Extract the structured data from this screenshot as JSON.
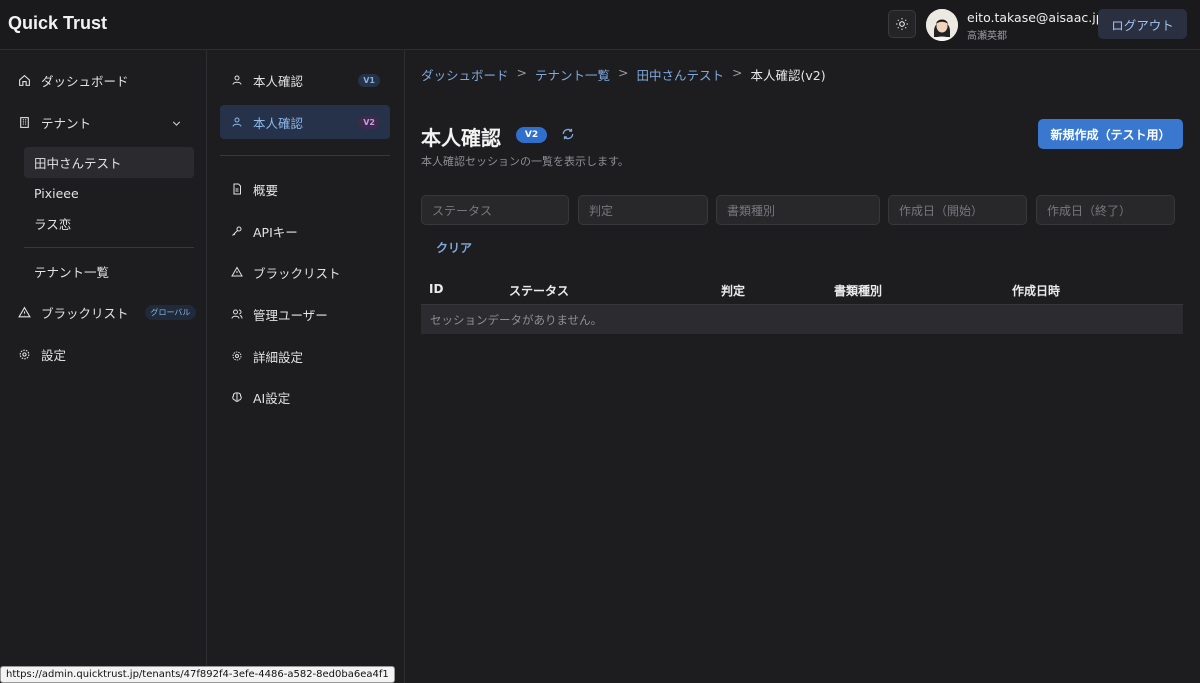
{
  "header": {
    "app_title": "Quick Trust",
    "user_email": "eito.takase@aisaac.jp",
    "user_name": "高瀬英都",
    "logout_label": "ログアウト",
    "theme_icon": "sun-icon"
  },
  "sidebar": {
    "dashboard": "ダッシュボード",
    "tenant": "テナント",
    "tenant_children": [
      "田中さんテスト",
      "Pixieee",
      "ラス恋"
    ],
    "tenant_list": "テナント一覧",
    "blacklist": "ブラックリスト",
    "global_badge": "グローバル",
    "settings": "設定"
  },
  "subnav": {
    "kyc_v1": "本人確認",
    "kyc_v1_badge": "V1",
    "kyc_v2": "本人確認",
    "kyc_v2_badge": "V2",
    "overview": "概要",
    "api_keys": "APIキー",
    "blacklist": "ブラックリスト",
    "admin_users": "管理ユーザー",
    "advanced_settings": "詳細設定",
    "ai_settings": "AI設定"
  },
  "breadcrumb": {
    "items": [
      "ダッシュボード",
      "テナント一覧",
      "田中さんテスト"
    ],
    "current": "本人確認(v2)",
    "separator": ">"
  },
  "main": {
    "title": "本人確認",
    "title_badge": "V2",
    "subtitle": "本人確認セッションの一覧を表示します。",
    "create_button": "新規作成（テスト用）",
    "filters": {
      "status": "ステータス",
      "judgement": "判定",
      "document_type": "書類種別",
      "created_from": "作成日（開始）",
      "created_to": "作成日（終了）"
    },
    "clear_button": "クリア",
    "table": {
      "columns": [
        "ID",
        "ステータス",
        "判定",
        "書類種別",
        "作成日時"
      ],
      "empty_message": "セッションデータがありません。"
    }
  },
  "status_bar": {
    "url": "https://admin.quicktrust.jp/tenants/47f892f4-3efe-4486-a582-8ed0ba6ea4f1"
  },
  "colors": {
    "background": "#1d1d20",
    "accent": "#3a78d0",
    "link": "#7fa9dc",
    "active_nav_bg": "#25324a"
  }
}
